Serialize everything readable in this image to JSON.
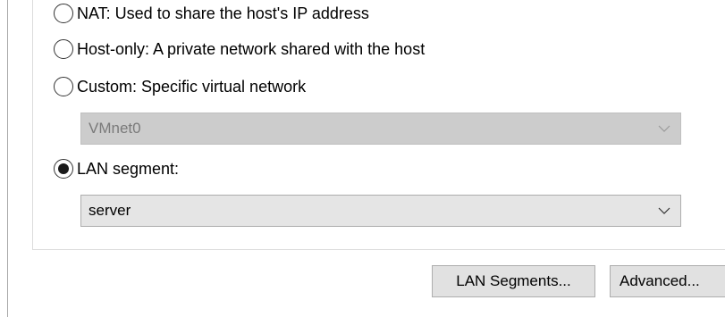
{
  "options": {
    "nat_label": "NAT: Used to share the host's IP address",
    "host_only_label": "Host-only: A private network shared with the host",
    "custom_label": "Custom: Specific virtual network",
    "lan_segment_label": "LAN segment:"
  },
  "selected_option": "lan_segment",
  "custom_network_select": {
    "value": "VMnet0",
    "enabled": false
  },
  "lan_segment_select": {
    "value": "server",
    "enabled": true
  },
  "buttons": {
    "lan_segments": "LAN Segments...",
    "advanced": "Advanced..."
  },
  "colors": {
    "disabled_combo_bg": "#cccccc",
    "enabled_combo_bg": "#e5e5e5",
    "button_bg": "#e1e1e1"
  }
}
